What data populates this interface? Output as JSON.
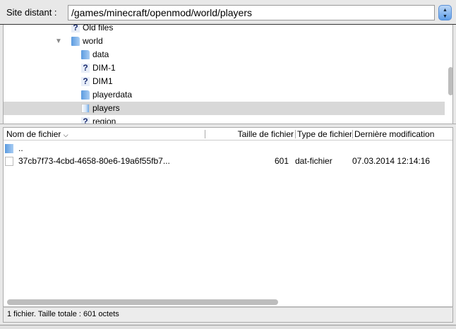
{
  "header": {
    "label": "Site distant :",
    "path": "/games/minecraft/openmod/world/players"
  },
  "tree": [
    {
      "name": "Old files",
      "icon": "unknown-folder-icon",
      "level": 1
    },
    {
      "name": "world",
      "icon": "folder-icon",
      "level": 1,
      "expanded": true
    },
    {
      "name": "data",
      "icon": "folder-icon",
      "level": 2
    },
    {
      "name": "DIM-1",
      "icon": "unknown-folder-icon",
      "level": 2
    },
    {
      "name": "DIM1",
      "icon": "unknown-folder-icon",
      "level": 2
    },
    {
      "name": "playerdata",
      "icon": "folder-icon",
      "level": 2
    },
    {
      "name": "players",
      "icon": "open-folder-icon",
      "level": 2,
      "selected": true
    },
    {
      "name": "region",
      "icon": "unknown-folder-icon",
      "level": 2
    }
  ],
  "list": {
    "columns": [
      "Nom de fichier",
      "Taille de fichier",
      "Type de fichier",
      "Dernière modification"
    ],
    "rows": [
      {
        "name": "..",
        "size": "",
        "type": "",
        "modified": "",
        "icon": "folder-icon"
      },
      {
        "name": "37cb7f73-4cbd-4658-80e6-19a6f55fb7...",
        "size": "601",
        "type": "dat-fichier",
        "modified": "07.03.2014 12:14:16",
        "icon": "file-icon"
      }
    ]
  },
  "status": "1 fichier. Taille totale : 601 octets"
}
